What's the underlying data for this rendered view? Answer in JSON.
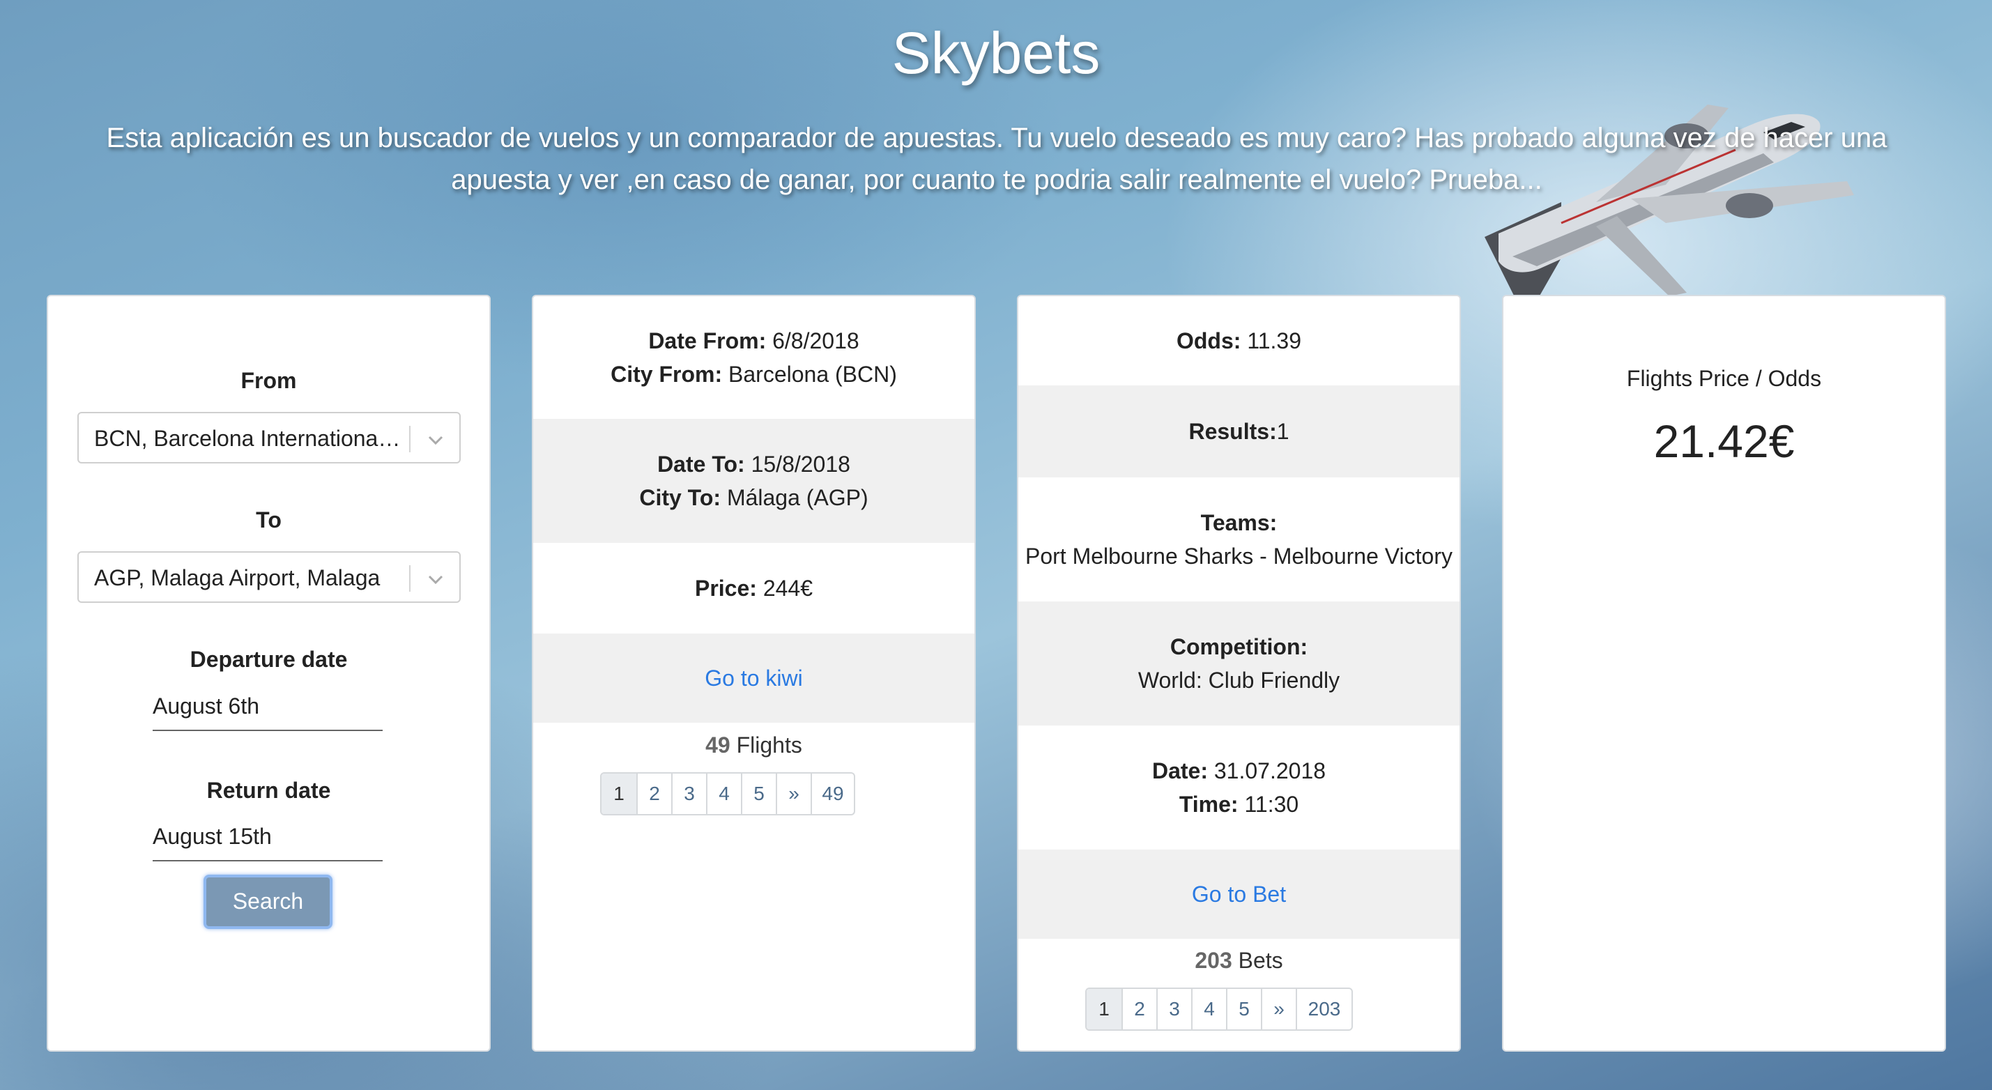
{
  "app": {
    "title": "Skybets",
    "description": "Esta aplicación es un buscador de vuelos y un comparador de apuestas. Tu vuelo deseado es muy caro? Has probado alguna vez de hacer una apuesta y ver ,en caso de ganar, por cuanto te podria salir realmente el vuelo? Prueba..."
  },
  "search": {
    "from_label": "From",
    "from_value": "BCN, Barcelona International Airport, Barcelona",
    "to_label": "To",
    "to_value": "AGP, Malaga Airport, Malaga",
    "departure_label": "Departure date",
    "departure_value": "August 6th",
    "return_label": "Return date",
    "return_value": "August 15th",
    "button_label": "Search"
  },
  "flight": {
    "date_from_label": "Date From:",
    "date_from": "6/8/2018",
    "city_from_label": "City From:",
    "city_from": "Barcelona (BCN)",
    "date_to_label": "Date To:",
    "date_to": "15/8/2018",
    "city_to_label": "City To:",
    "city_to": "Málaga (AGP)",
    "price_label": "Price:",
    "price": "244€",
    "link_label": "Go to kiwi",
    "count": "49",
    "count_suffix": "Flights",
    "pages": [
      "1",
      "2",
      "3",
      "4",
      "5",
      "»",
      "49"
    ]
  },
  "bet": {
    "odds_label": "Odds:",
    "odds": "11.39",
    "results_label": "Results:",
    "results": "1",
    "teams_label": "Teams:",
    "teams": "Port Melbourne Sharks - Melbourne Victory",
    "competition_label": "Competition:",
    "competition": "World: Club Friendly",
    "date_label": "Date:",
    "date": "31.07.2018",
    "time_label": "Time:",
    "time": "11:30",
    "link_label": "Go to Bet",
    "count": "203",
    "count_suffix": "Bets",
    "pages": [
      "1",
      "2",
      "3",
      "4",
      "5",
      "»",
      "203"
    ]
  },
  "ratio": {
    "label": "Flights Price / Odds",
    "value": "21.42€"
  },
  "colors": {
    "link": "#2a7ae2",
    "button": "#7b98b4",
    "row_shade": "#f0f0f0"
  }
}
